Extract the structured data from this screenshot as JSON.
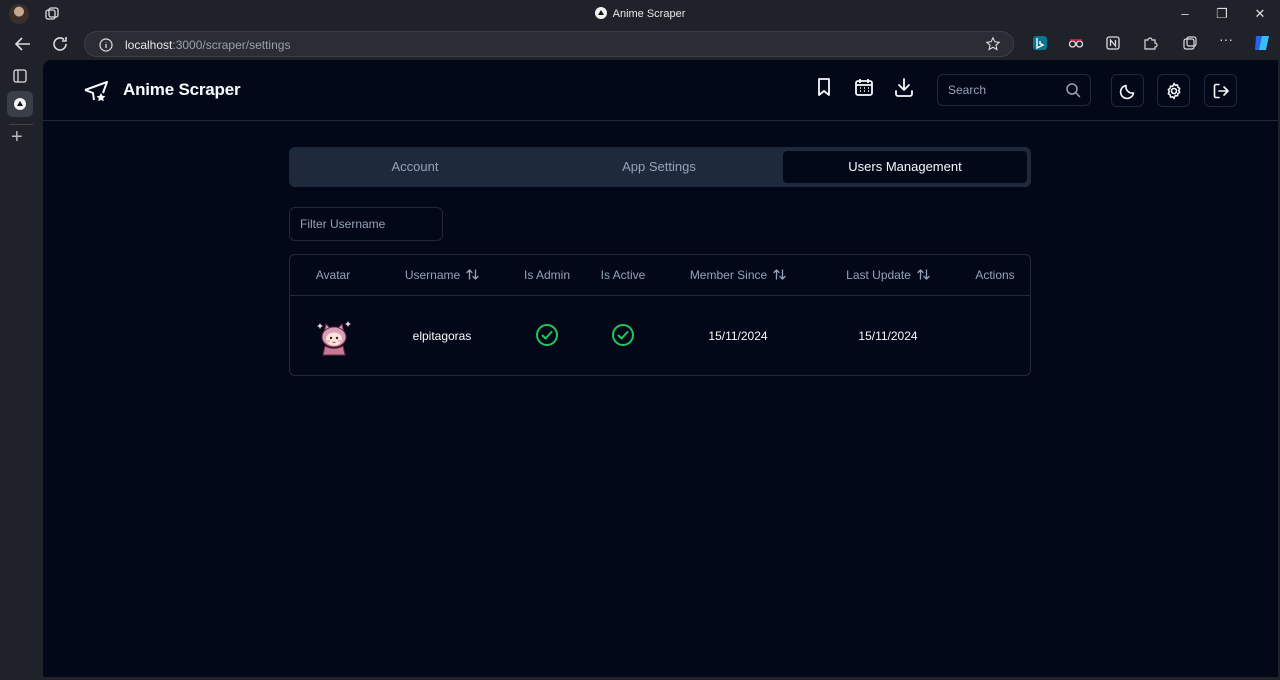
{
  "browser": {
    "window_title": "Anime Scraper",
    "url_host": "localhost",
    "url_path": ":3000/scraper/settings"
  },
  "app": {
    "title": "Anime Scraper",
    "search_placeholder": "Search"
  },
  "tabs": [
    {
      "label": "Account",
      "active": false
    },
    {
      "label": "App Settings",
      "active": false
    },
    {
      "label": "Users Management",
      "active": true
    }
  ],
  "filter": {
    "placeholder": "Filter Username"
  },
  "table": {
    "columns": [
      "Avatar",
      "Username",
      "Is Admin",
      "Is Active",
      "Member Since",
      "Last Update",
      "Actions"
    ],
    "sortable_columns": [
      "Username",
      "Member Since",
      "Last Update"
    ],
    "rows": [
      {
        "username": "elpitagoras",
        "is_admin": true,
        "is_active": true,
        "member_since": "15/11/2024",
        "last_update": "15/11/2024"
      }
    ]
  },
  "colors": {
    "page_bg": "#020817",
    "border": "#1e293b",
    "check_green": "#22c55e",
    "muted_text": "#94a3b8"
  },
  "icons": [
    "logo-icon",
    "bookmark-icon",
    "calendar-icon",
    "download-icon",
    "search-icon",
    "moon-icon",
    "gear-icon",
    "logout-icon",
    "sort-icon",
    "check-circle-icon"
  ]
}
